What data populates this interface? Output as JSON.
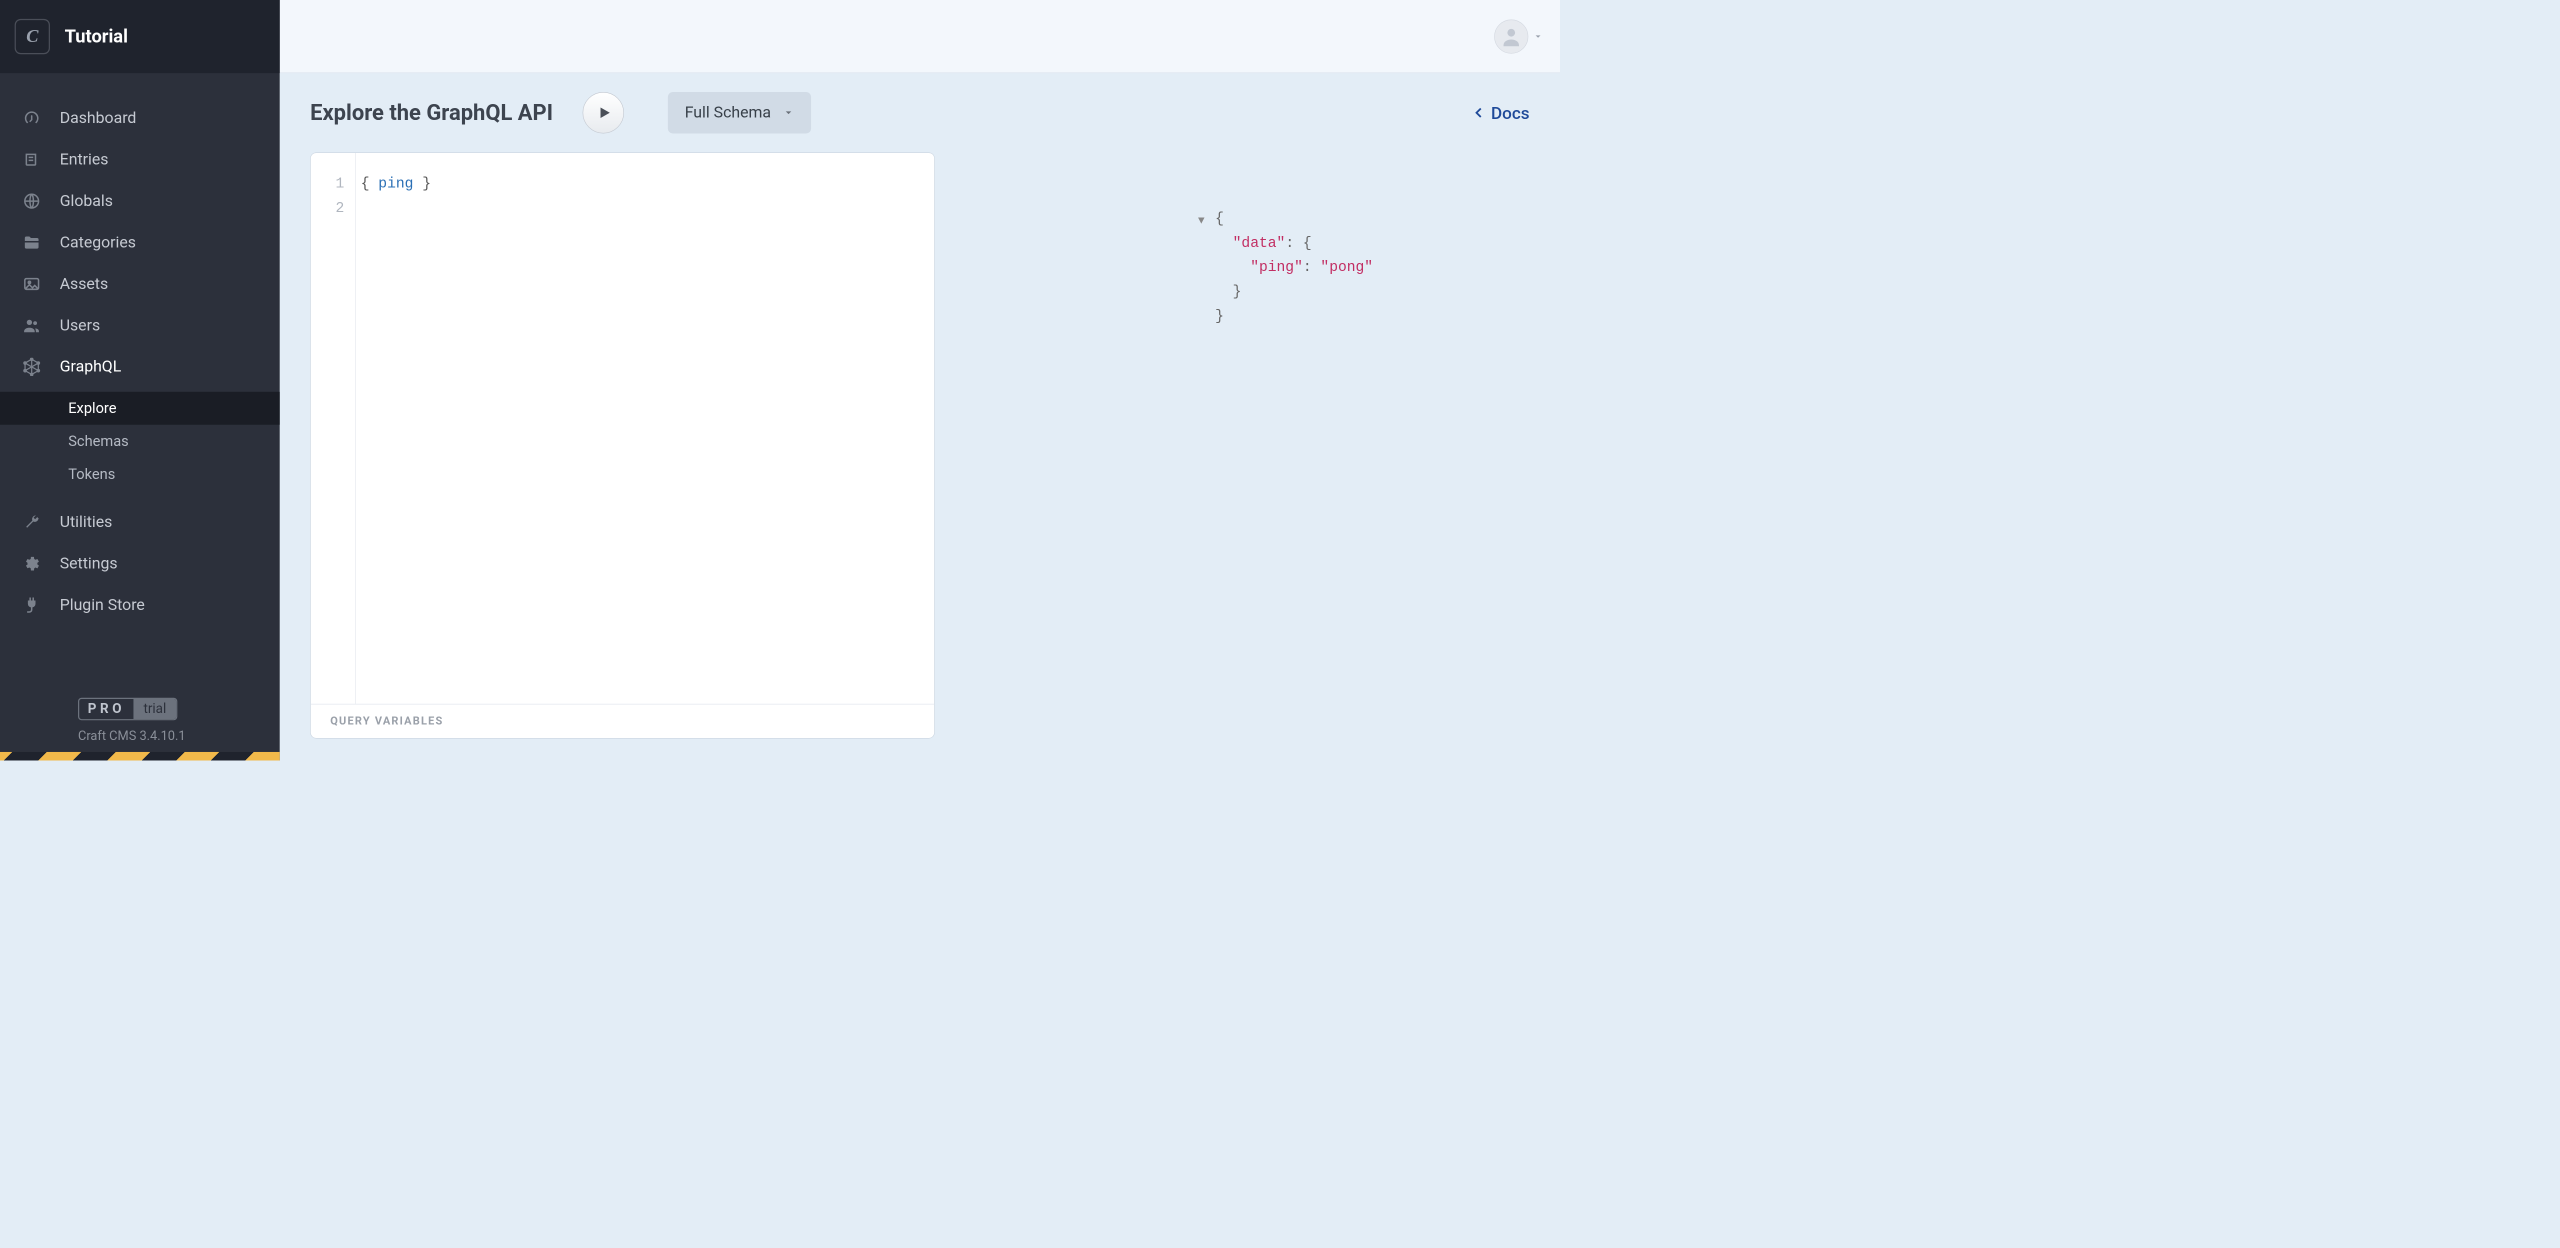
{
  "app_name": "Tutorial",
  "logo_letter": "C",
  "nav": {
    "items": [
      {
        "label": "Dashboard",
        "icon": "gauge"
      },
      {
        "label": "Entries",
        "icon": "news"
      },
      {
        "label": "Globals",
        "icon": "globe"
      },
      {
        "label": "Categories",
        "icon": "folder"
      },
      {
        "label": "Assets",
        "icon": "image"
      },
      {
        "label": "Users",
        "icon": "users"
      },
      {
        "label": "GraphQL",
        "icon": "graphql",
        "expanded": true,
        "subitems": [
          {
            "label": "Explore",
            "active": true
          },
          {
            "label": "Schemas"
          },
          {
            "label": "Tokens"
          }
        ]
      },
      {
        "label": "Utilities",
        "icon": "wrench"
      },
      {
        "label": "Settings",
        "icon": "gear"
      },
      {
        "label": "Plugin Store",
        "icon": "plug"
      }
    ]
  },
  "edition": {
    "pro_label": "PRO",
    "trial_label": "trial"
  },
  "version_text": "Craft CMS 3.4.10.1",
  "page": {
    "title": "Explore the GraphQL API",
    "schema_selector": "Full Schema",
    "docs_link": "Docs",
    "query_variables_label": "QUERY VARIABLES"
  },
  "editor": {
    "line_numbers": [
      "1",
      "2"
    ],
    "query": "{ ping }"
  },
  "response_json": {
    "data": {
      "ping": "pong"
    }
  }
}
